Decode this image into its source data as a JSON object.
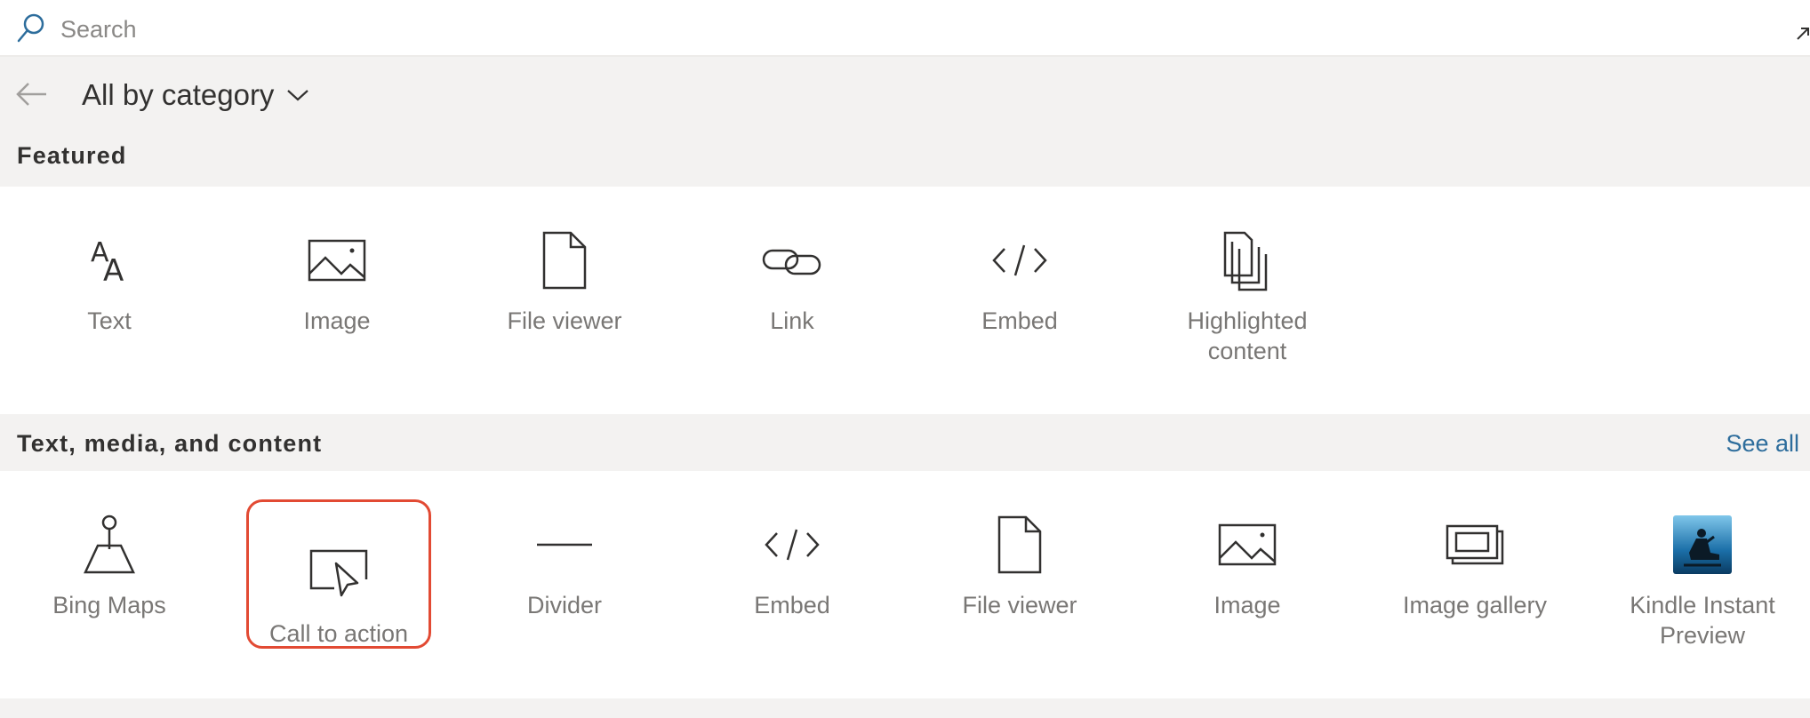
{
  "search": {
    "placeholder": "Search"
  },
  "nav": {
    "category_label": "All by category"
  },
  "sections": {
    "featured": {
      "title": "Featured",
      "items": [
        {
          "label": "Text",
          "icon": "text-icon"
        },
        {
          "label": "Image",
          "icon": "image-icon"
        },
        {
          "label": "File viewer",
          "icon": "file-icon"
        },
        {
          "label": "Link",
          "icon": "link-icon"
        },
        {
          "label": "Embed",
          "icon": "code-icon"
        },
        {
          "label": "Highlighted content",
          "icon": "highlighted-content-icon"
        }
      ]
    },
    "text_media": {
      "title": "Text, media, and content",
      "see_all": "See all",
      "items": [
        {
          "label": "Bing Maps",
          "icon": "map-icon"
        },
        {
          "label": "Call to action",
          "icon": "call-to-action-icon",
          "selected": true
        },
        {
          "label": "Divider",
          "icon": "divider-icon"
        },
        {
          "label": "Embed",
          "icon": "code-icon"
        },
        {
          "label": "File viewer",
          "icon": "file-icon"
        },
        {
          "label": "Image",
          "icon": "image-icon"
        },
        {
          "label": "Image gallery",
          "icon": "image-gallery-icon"
        },
        {
          "label": "Kindle Instant Preview",
          "icon": "kindle-icon"
        }
      ]
    }
  },
  "colors": {
    "accent": "#2d6d9c",
    "selection_border": "#e24a33",
    "header_bg": "#f3f2f1",
    "label_gray": "#797775"
  }
}
